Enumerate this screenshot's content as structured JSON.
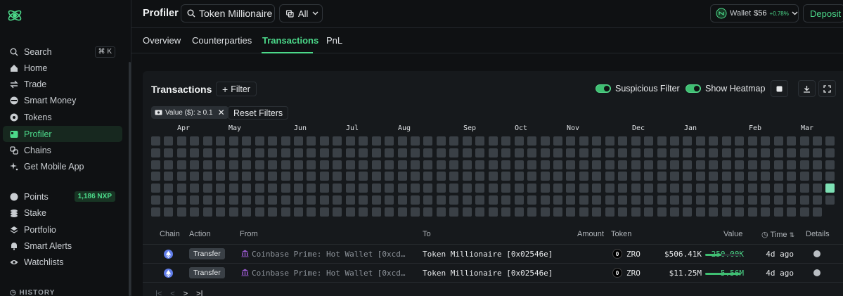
{
  "sidebar": {
    "search_shortcut": "⌘ K",
    "items": [
      {
        "label": "Search",
        "icon": "search-icon"
      },
      {
        "label": "Home",
        "icon": "home-icon"
      },
      {
        "label": "Trade",
        "icon": "trade-icon"
      },
      {
        "label": "Smart Money",
        "icon": "smart-money-icon"
      },
      {
        "label": "Tokens",
        "icon": "tokens-icon"
      },
      {
        "label": "Profiler",
        "icon": "profiler-icon",
        "active": true
      },
      {
        "label": "Chains",
        "icon": "chains-icon"
      },
      {
        "label": "Get Mobile App",
        "icon": "sparkle-icon"
      },
      {
        "label": "Points",
        "icon": "points-icon",
        "badge": "1,186 NXP"
      },
      {
        "label": "Stake",
        "icon": "stake-icon"
      },
      {
        "label": "Portfolio",
        "icon": "portfolio-icon"
      },
      {
        "label": "Smart Alerts",
        "icon": "bell-icon"
      },
      {
        "label": "Watchlists",
        "icon": "eye-icon"
      }
    ],
    "history_label": "HISTORY"
  },
  "header": {
    "title": "Profiler",
    "search_value": "Token Millionaire",
    "scope": "All",
    "wallet_label": "Wallet",
    "wallet_value": "$56",
    "wallet_change": "+0.78%",
    "deposit_label": "Deposit"
  },
  "tabs": [
    {
      "label": "Overview"
    },
    {
      "label": "Counterparties"
    },
    {
      "label": "Transactions",
      "active": true
    },
    {
      "label": "PnL"
    }
  ],
  "card": {
    "title": "Transactions",
    "filter_label": "Filter",
    "suspicious_label": "Suspicious Filter",
    "heatmap_label": "Show Heatmap",
    "chip_label": "Value ($): ≥ 0.1",
    "reset_label": "Reset Filters"
  },
  "heatmap": {
    "months": [
      "Apr",
      "May",
      "Jun",
      "Jul",
      "Aug",
      "Sep",
      "Oct",
      "Nov",
      "Dec",
      "Jan",
      "Feb",
      "Mar"
    ],
    "weeks": 53,
    "days": 7,
    "last_week_days": 6,
    "hot_cell": {
      "week": 52,
      "day": 4
    },
    "empty_color": "#3a4046",
    "hot_color": "#7ee0b4"
  },
  "table": {
    "headers": {
      "chain": "Chain",
      "action": "Action",
      "from": "From",
      "to": "To",
      "amount": "Amount",
      "token": "Token",
      "value": "Value",
      "time": "Time",
      "details": "Details"
    },
    "rows": [
      {
        "chain": "ethereum",
        "action": "Transfer",
        "from": "Coinbase Prime: Hot Wallet [0xcd…",
        "to": "Token Millionaire [0x02546e]",
        "amount": "250.00K",
        "token": "ZRO",
        "value": "$506.41K",
        "value_fraction": 0.45,
        "time": "4d ago"
      },
      {
        "chain": "ethereum",
        "action": "Transfer",
        "from": "Coinbase Prime: Hot Wallet [0xcd…",
        "to": "Token Millionaire [0x02546e]",
        "amount": "5.56M",
        "token": "ZRO",
        "value": "$11.25M",
        "value_fraction": 1.0,
        "time": "4d ago"
      }
    ]
  },
  "colors": {
    "accent": "#4cd98a",
    "bg": "#0f1113",
    "card": "#16191c"
  }
}
